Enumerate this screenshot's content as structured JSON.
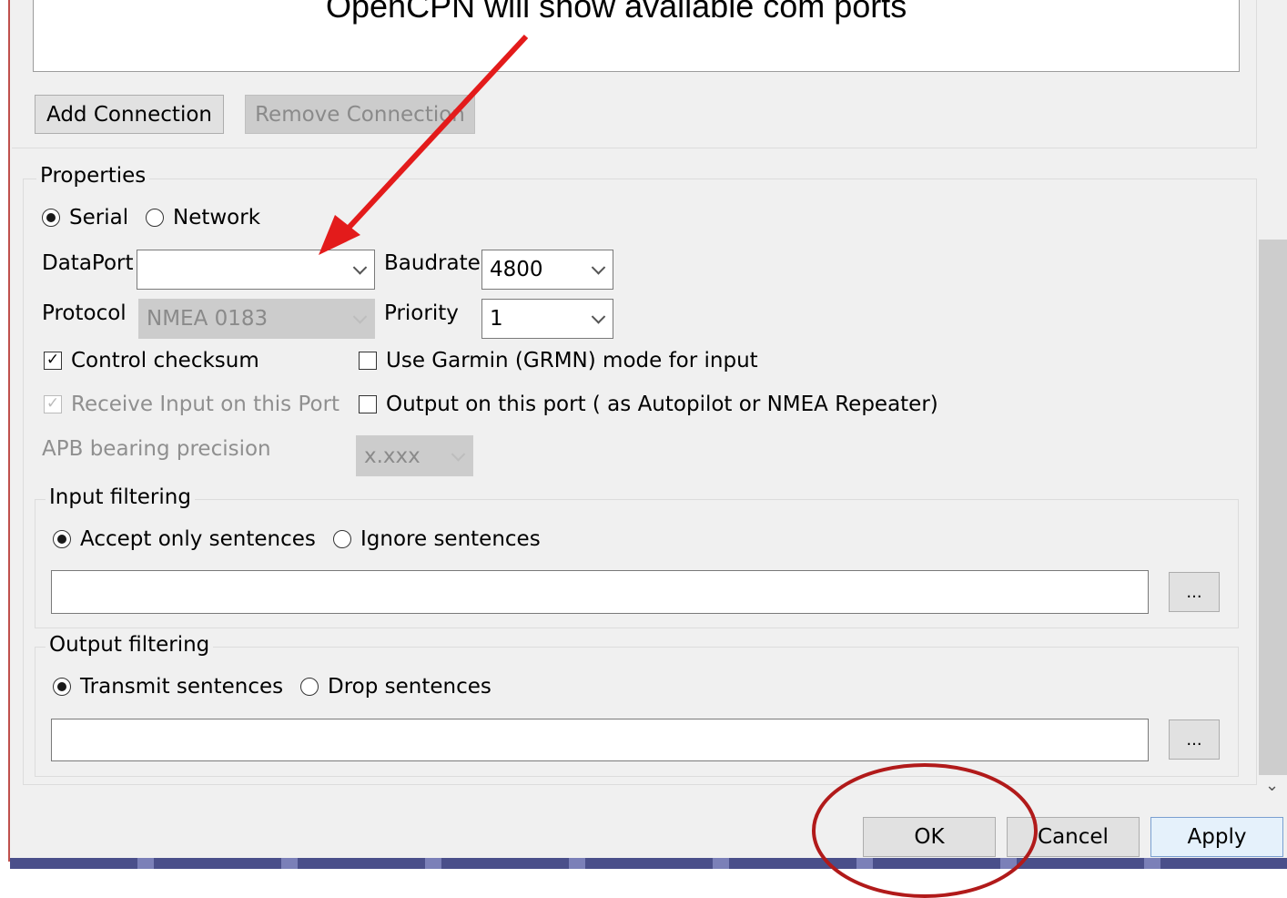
{
  "annotation": {
    "text": "OpenCPN will show available com ports",
    "arrow_color": "#e31b1b",
    "circle_color": "#b11a1a"
  },
  "connections": {
    "add_label": "Add Connection",
    "remove_label": "Remove Connection"
  },
  "properties": {
    "legend": "Properties",
    "type_serial": "Serial",
    "type_network": "Network",
    "selected_type": "Serial",
    "dataport_label": "DataPort",
    "dataport_value": "",
    "baudrate_label": "Baudrate",
    "baudrate_value": "4800",
    "protocol_label": "Protocol",
    "protocol_value": "NMEA 0183",
    "priority_label": "Priority",
    "priority_value": "1",
    "control_checksum": "Control checksum",
    "control_checksum_checked": true,
    "garmin_mode": "Use Garmin (GRMN) mode for input",
    "garmin_mode_checked": false,
    "receive_input": "Receive Input on this Port",
    "receive_input_checked": true,
    "output_port": "Output on this port ( as Autopilot or NMEA Repeater)",
    "output_port_checked": false,
    "apb_label": "APB bearing precision",
    "apb_value": "x.xxx"
  },
  "input_filtering": {
    "legend": "Input filtering",
    "accept": "Accept only sentences",
    "ignore": "Ignore sentences",
    "selected": "Accept only sentences",
    "value": "",
    "more_label": "..."
  },
  "output_filtering": {
    "legend": "Output filtering",
    "transmit": "Transmit sentences",
    "drop": "Drop sentences",
    "selected": "Transmit sentences",
    "value": "",
    "more_label": "..."
  },
  "footer": {
    "ok_label": "OK",
    "cancel_label": "Cancel",
    "apply_label": "Apply"
  }
}
